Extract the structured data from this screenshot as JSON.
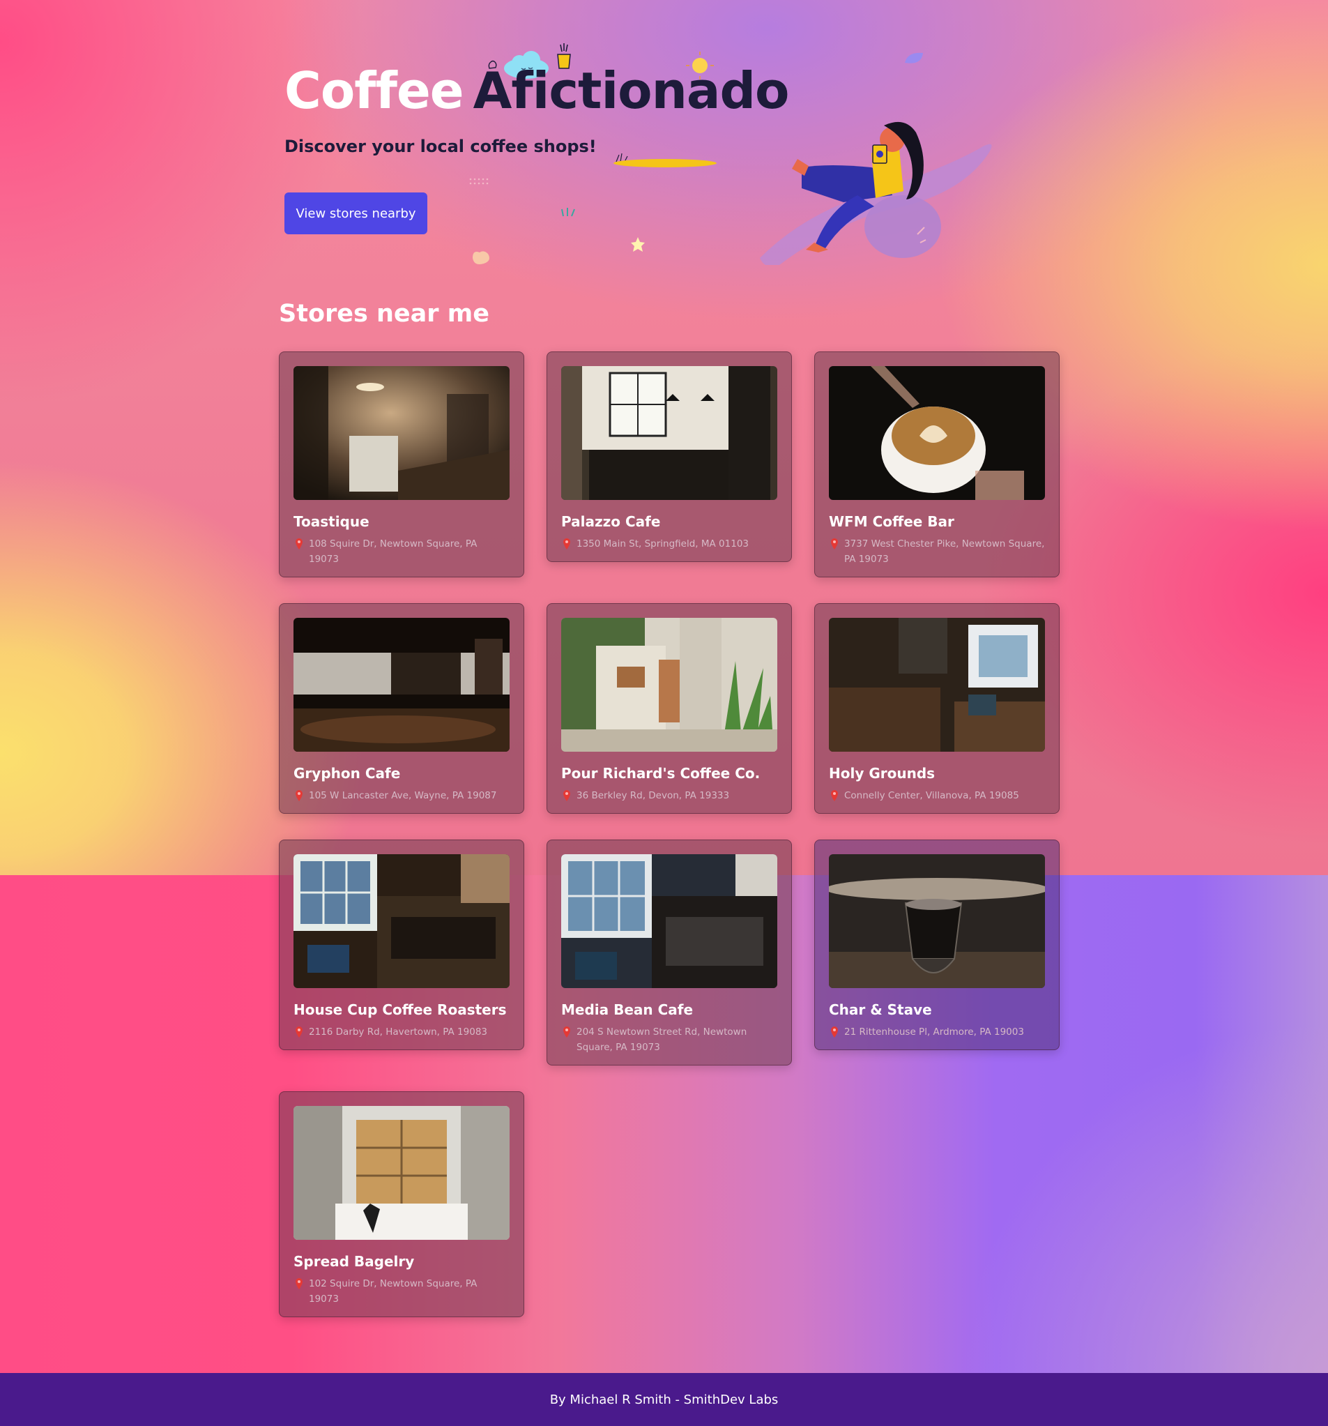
{
  "hero": {
    "title_word1": "Coffee",
    "title_word2": "Afictionado",
    "subtitle": "Discover your local coffee shops!",
    "cta_label": "View stores nearby"
  },
  "section": {
    "title": "Stores near me"
  },
  "stores": [
    {
      "name": "Toastique",
      "address": "108 Squire Dr, Newtown Square, PA 19073"
    },
    {
      "name": "Palazzo Cafe",
      "address": "1350 Main St, Springfield, MA 01103"
    },
    {
      "name": "WFM Coffee Bar",
      "address": "3737 West Chester Pike, Newtown Square, PA 19073"
    },
    {
      "name": "Gryphon Cafe",
      "address": "105 W Lancaster Ave, Wayne, PA 19087"
    },
    {
      "name": "Pour Richard's Coffee Co.",
      "address": "36 Berkley Rd, Devon, PA 19333"
    },
    {
      "name": "Holy Grounds",
      "address": "Connelly Center, Villanova, PA 19085"
    },
    {
      "name": "House Cup Coffee Roasters",
      "address": "2116 Darby Rd, Havertown, PA 19083"
    },
    {
      "name": "Media Bean Cafe",
      "address": "204 S Newtown Street Rd, Newtown Square, PA 19073"
    },
    {
      "name": "Char & Stave",
      "address": "21 Rittenhouse Pl, Ardmore, PA 19003"
    },
    {
      "name": "Spread Bagelry",
      "address": "102 Squire Dr, Newtown Square, PA 19073"
    }
  ],
  "footer": {
    "text": "By Michael R Smith - SmithDev Labs"
  },
  "colors": {
    "accent_button": "#4f46e5",
    "footer_bg": "#4a1a8c",
    "title_dark": "#1d1b3a"
  },
  "icons": [
    "location-pin-icon",
    "coffee-cup-icon",
    "cloud-icon",
    "sun-icon"
  ]
}
